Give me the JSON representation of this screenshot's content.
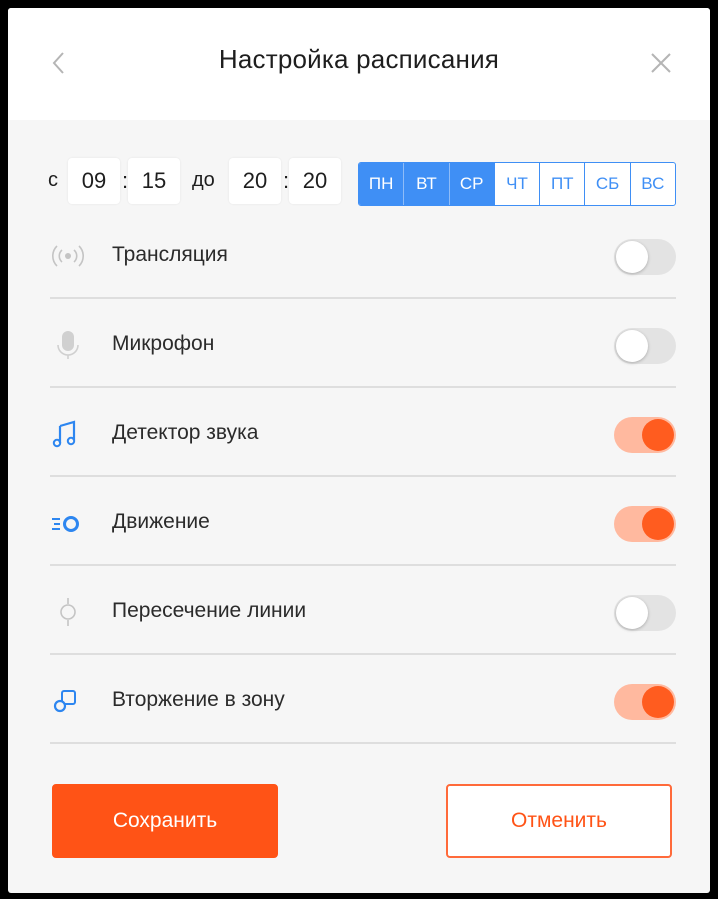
{
  "header": {
    "title": "Настройка расписания",
    "back_icon": "chevron-left-icon",
    "close_icon": "close-icon"
  },
  "time": {
    "from_label": "с",
    "from_hours": "09",
    "from_minutes": "15",
    "to_label": "до",
    "to_hours": "20",
    "to_minutes": "20",
    "separator": ":"
  },
  "days": [
    {
      "label": "ПН",
      "selected": true
    },
    {
      "label": "ВТ",
      "selected": true
    },
    {
      "label": "СР",
      "selected": true
    },
    {
      "label": "ЧТ",
      "selected": false
    },
    {
      "label": "ПТ",
      "selected": false
    },
    {
      "label": "СБ",
      "selected": false
    },
    {
      "label": "ВС",
      "selected": false
    }
  ],
  "settings": [
    {
      "label": "Трансляция",
      "icon": "broadcast-icon",
      "enabled": false
    },
    {
      "label": "Микрофон",
      "icon": "microphone-icon",
      "enabled": false
    },
    {
      "label": "Детектор звука",
      "icon": "music-note-icon",
      "enabled": true
    },
    {
      "label": "Движение",
      "icon": "motion-icon",
      "enabled": true
    },
    {
      "label": "Пересечение линии",
      "icon": "line-crossing-icon",
      "enabled": false
    },
    {
      "label": "Вторжение в зону",
      "icon": "zone-intrusion-icon",
      "enabled": true
    }
  ],
  "buttons": {
    "save_label": "Сохранить",
    "cancel_label": "Отменить"
  },
  "colors": {
    "accent": "#ff5316",
    "toggle_on_track": "#ffb99f",
    "toggle_on_knob": "#ff5c1f",
    "day_blue": "#3f8ff5"
  }
}
